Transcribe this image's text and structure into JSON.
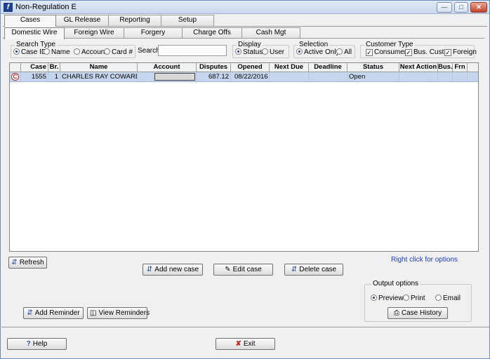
{
  "window": {
    "title": "Non-Regulation E"
  },
  "main_tabs": [
    {
      "label": "Cases"
    },
    {
      "label": "GL Release"
    },
    {
      "label": "Reporting"
    },
    {
      "label": "Setup"
    }
  ],
  "sub_tabs": [
    {
      "label": "Domestic Wire"
    },
    {
      "label": "Foreign Wire"
    },
    {
      "label": "Forgery"
    },
    {
      "label": "Charge Offs"
    },
    {
      "label": "Cash Mgt"
    }
  ],
  "search_type": {
    "legend": "Search Type",
    "options": [
      "Case ID",
      "Name",
      "Account",
      "Card #"
    ],
    "selected": "Case ID"
  },
  "search": {
    "label": "Search",
    "value": ""
  },
  "display": {
    "legend": "Display",
    "options": [
      "Status",
      "User"
    ],
    "selected": "Status"
  },
  "selection": {
    "legend": "Selection",
    "options": [
      "Active Only",
      "All"
    ],
    "selected": "Active Only"
  },
  "customer_type": {
    "legend": "Customer Type",
    "options": [
      "Consumer",
      "Bus. Cust.",
      "Foreign"
    ],
    "checked": [
      true,
      true,
      true
    ]
  },
  "grid": {
    "columns": [
      "",
      "Case",
      "Br.",
      "Name",
      "Account",
      "Disputes",
      "Opened",
      "Next Due",
      "Deadline",
      "Status",
      "Next Action",
      "Bus.",
      "Frn"
    ],
    "rows": [
      {
        "icon": "case-icon",
        "case": "1555",
        "br": "1",
        "name": "CHARLES RAY COWARD",
        "account": "",
        "disputes": "687.12",
        "opened": "08/22/2016",
        "next_due": "",
        "deadline": "",
        "status": "Open",
        "next_action": "",
        "bus": "",
        "frn": ""
      }
    ]
  },
  "buttons": {
    "refresh": "Refresh",
    "add_new_case": "Add new case",
    "edit_case": "Edit case",
    "delete_case": "Delete case",
    "add_reminder": "Add Reminder",
    "view_reminders": "View Reminders",
    "case_history": "Case History",
    "help": "Help",
    "exit": "Exit"
  },
  "hint": "Right click for options",
  "output_options": {
    "legend": "Output options",
    "options": [
      "Preview",
      "Print",
      "Email"
    ],
    "selected": "Preview"
  }
}
